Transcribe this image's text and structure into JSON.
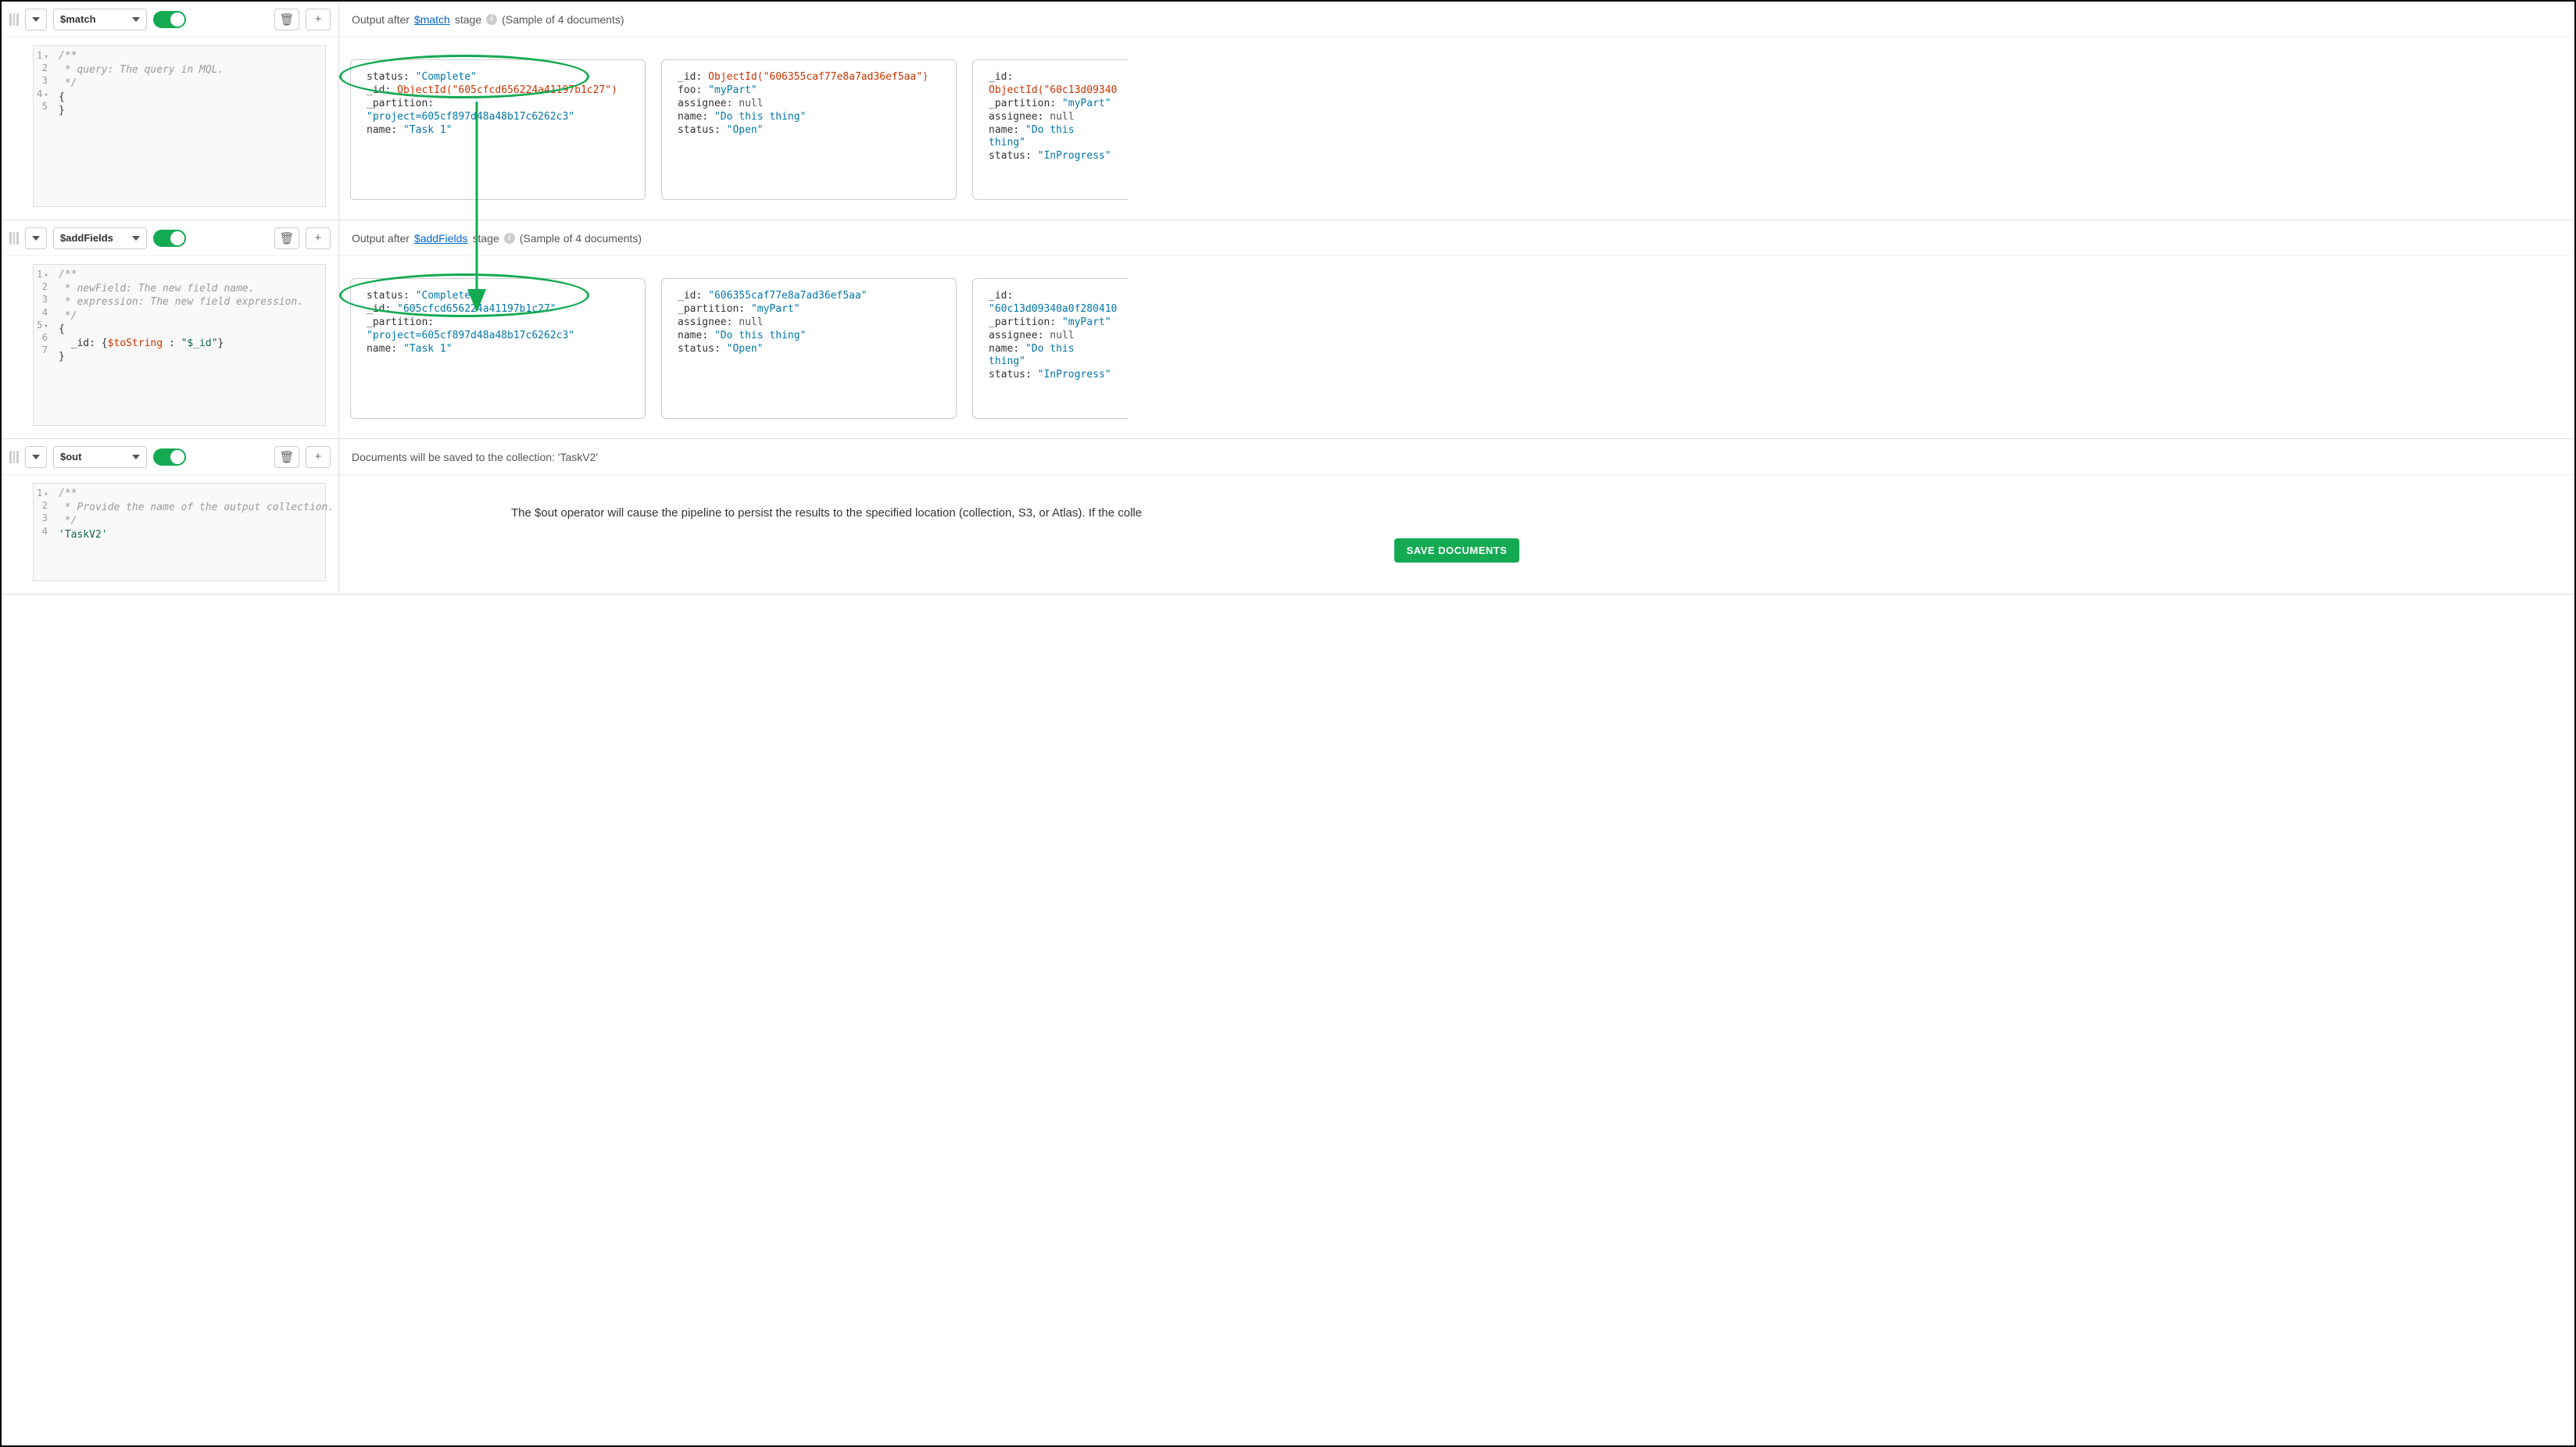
{
  "stages": [
    {
      "operator": "$match",
      "editor": {
        "line1": "/**",
        "line2": " * query: The query in MQL.",
        "line3": " */",
        "line4": "{",
        "line5": "}"
      },
      "output": {
        "prefix": "Output after ",
        "stage_link": "$match",
        "suffix": " stage",
        "sample": "(Sample of 4 documents)"
      },
      "docs": [
        {
          "fields": [
            {
              "k": "status",
              "v": "\"Complete\"",
              "cls": "fstr"
            },
            {
              "k": "_id",
              "v": "ObjectId(\"605cfcd656224a41197b1c27\")",
              "cls": "fobj"
            },
            {
              "k": "_partition",
              "v": "\"project=605cf897d48a48b17c6262c3\"",
              "cls": "fstr"
            },
            {
              "k": "name",
              "v": "\"Task 1\"",
              "cls": "fstr"
            }
          ]
        },
        {
          "fields": [
            {
              "k": "_id",
              "v": "ObjectId(\"606355caf77e8a7ad36ef5aa\")",
              "cls": "fobj"
            },
            {
              "k": "foo",
              "v": "\"myPart\"",
              "cls": "fstr"
            },
            {
              "k": "assignee",
              "v": "null",
              "cls": "fnull"
            },
            {
              "k": "name",
              "v": "\"Do this thing\"",
              "cls": "fstr"
            },
            {
              "k": "status",
              "v": "\"Open\"",
              "cls": "fstr"
            }
          ]
        },
        {
          "fields": [
            {
              "k": "_id",
              "v": "ObjectId(\"60c13d09340",
              "cls": "fobj"
            },
            {
              "k": "_partition",
              "v": "\"myPart\"",
              "cls": "fstr"
            },
            {
              "k": "assignee",
              "v": "null",
              "cls": "fnull"
            },
            {
              "k": "name",
              "v": "\"Do this thing\"",
              "cls": "fstr"
            },
            {
              "k": "status",
              "v": "\"InProgress\"",
              "cls": "fstr"
            }
          ]
        }
      ]
    },
    {
      "operator": "$addFields",
      "editor": {
        "line1": "/**",
        "line2": " * newField: The new field name.",
        "line3": " * expression: The new field expression.",
        "line4": " */",
        "line5": "{",
        "line6_key": "  _id: ",
        "line6_op": "$toString",
        "line6_mid": " : ",
        "line6_val": "\"$_id\"",
        "line7": "}"
      },
      "output": {
        "prefix": "Output after ",
        "stage_link": "$addFields",
        "suffix": " stage",
        "sample": "(Sample of 4 documents)"
      },
      "docs": [
        {
          "fields": [
            {
              "k": "status",
              "v": "\"Complete\"",
              "cls": "fstr"
            },
            {
              "k": "_id",
              "v": "\"605cfcd656224a41197b1c27\"",
              "cls": "fstr"
            },
            {
              "k": "_partition",
              "v": "\"project=605cf897d48a48b17c6262c3\"",
              "cls": "fstr"
            },
            {
              "k": "name",
              "v": "\"Task 1\"",
              "cls": "fstr"
            }
          ]
        },
        {
          "fields": [
            {
              "k": "_id",
              "v": "\"606355caf77e8a7ad36ef5aa\"",
              "cls": "fstr"
            },
            {
              "k": "_partition",
              "v": "\"myPart\"",
              "cls": "fstr"
            },
            {
              "k": "assignee",
              "v": "null",
              "cls": "fnull"
            },
            {
              "k": "name",
              "v": "\"Do this thing\"",
              "cls": "fstr"
            },
            {
              "k": "status",
              "v": "\"Open\"",
              "cls": "fstr"
            }
          ]
        },
        {
          "fields": [
            {
              "k": "_id",
              "v": "\"60c13d09340a0f280410",
              "cls": "fstr"
            },
            {
              "k": "_partition",
              "v": "\"myPart\"",
              "cls": "fstr"
            },
            {
              "k": "assignee",
              "v": "null",
              "cls": "fnull"
            },
            {
              "k": "name",
              "v": "\"Do this thing\"",
              "cls": "fstr"
            },
            {
              "k": "status",
              "v": "\"InProgress\"",
              "cls": "fstr"
            }
          ]
        }
      ]
    },
    {
      "operator": "$out",
      "editor": {
        "line1": "/**",
        "line2": " * Provide the name of the output collection.",
        "line3": " */",
        "line4": "'TaskV2'"
      },
      "out_header": "Documents will be saved to the collection: 'TaskV2'",
      "out_body": "The $out operator will cause the pipeline to persist the results to the specified location (collection, S3, or Atlas). If the colle",
      "save_label": "SAVE DOCUMENTS"
    }
  ]
}
